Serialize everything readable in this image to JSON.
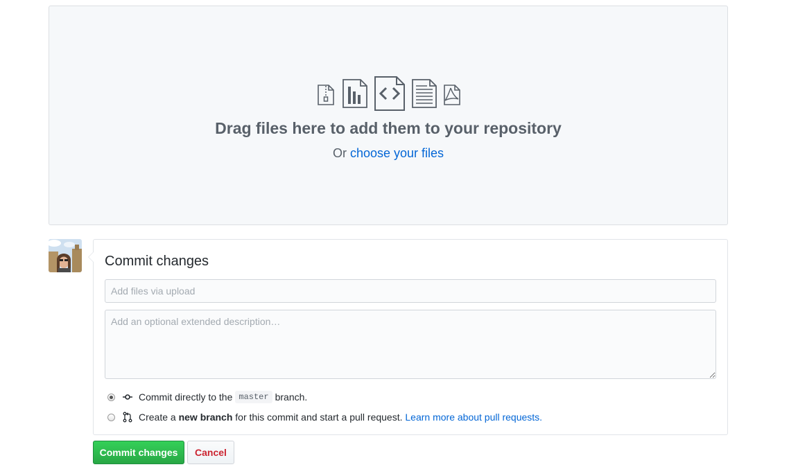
{
  "dropzone": {
    "icons": [
      "file-zip-icon",
      "graph-icon",
      "file-code-icon",
      "file-text-icon",
      "file-pdf-icon"
    ],
    "title": "Drag files here to add them to your repository",
    "sub_prefix": "Or",
    "choose_link": "choose your files"
  },
  "commit": {
    "avatar_icon": "user-avatar",
    "title": "Commit changes",
    "summary_placeholder": "Add files via upload",
    "description_placeholder": "Add an optional extended description…",
    "option_direct": {
      "prefix": "Commit directly to the",
      "branch": "master",
      "suffix": "branch.",
      "checked": true,
      "icon": "git-commit-icon"
    },
    "option_new": {
      "prefix": "Create a",
      "bold": "new branch",
      "suffix": "for this commit and start a pull request.",
      "link": "Learn more about pull requests.",
      "checked": false,
      "icon": "git-pull-request-icon"
    }
  },
  "buttons": {
    "commit": "Commit changes",
    "cancel": "Cancel"
  },
  "colors": {
    "link": "#0366d6",
    "commit_button": "#28a745",
    "cancel_text": "#cb2431",
    "dropzone_bg": "#f6f8fa"
  }
}
